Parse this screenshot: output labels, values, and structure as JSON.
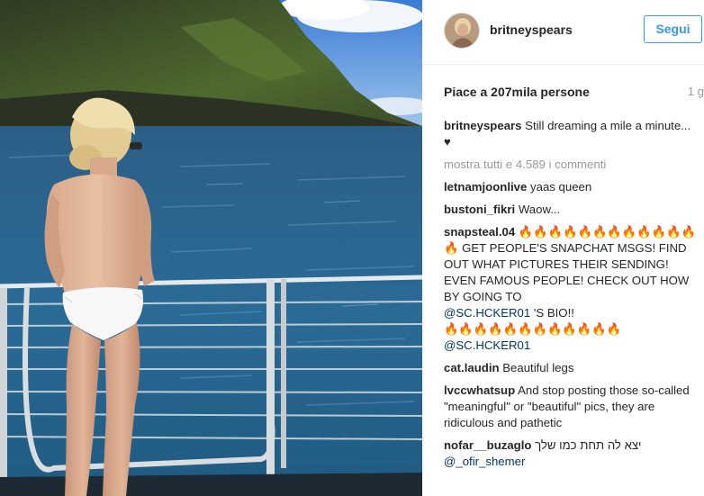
{
  "post": {
    "username": "britneyspears",
    "follow_label": "Segui",
    "likes": "Piace a 207mila persone",
    "time": "1 g",
    "caption": {
      "user": "britneyspears",
      "text": "Still dreaming a mile a minute...",
      "emoji": "♥"
    },
    "view_all": "mostra tutti e 4.589 i commenti"
  },
  "comments": [
    {
      "user": "letnamjoonlive",
      "text": "yaas queen"
    },
    {
      "user": "bustoni_fikri",
      "text": "Waow..."
    },
    {
      "user": "snapsteal.04",
      "fire_start": "🔥🔥🔥🔥🔥🔥🔥🔥🔥🔥🔥🔥",
      "fire_mid": "🔥",
      "text": "GET PEOPLE'S SNAPCHAT MSGS! FIND OUT WHAT PICTURES THEIR SENDING! EVEN FAMOUS PEOPLE! CHECK OUT HOW BY GOING TO",
      "mention1": "@SC.HCKER01",
      "text2": "'S BIO!!",
      "fire_end": "🔥🔥🔥🔥🔥🔥🔥🔥🔥🔥🔥🔥",
      "mention2": "@SC.HCKER01"
    },
    {
      "user": "cat.laudin",
      "text": "Beautiful legs"
    },
    {
      "user": "lvccwhatsup",
      "text": "And stop posting those so-called \"meaningful\" or \"beautiful\" pics, they are ridiculous and pathetic"
    },
    {
      "user": "nofar__buzaglo",
      "text": "יצא לה תחת כמו שלך",
      "mention": "@_ofir_shemer"
    }
  ],
  "icons": {
    "avatar": "profile-avatar",
    "heart": "heart-emoji",
    "fire": "fire-emoji"
  }
}
